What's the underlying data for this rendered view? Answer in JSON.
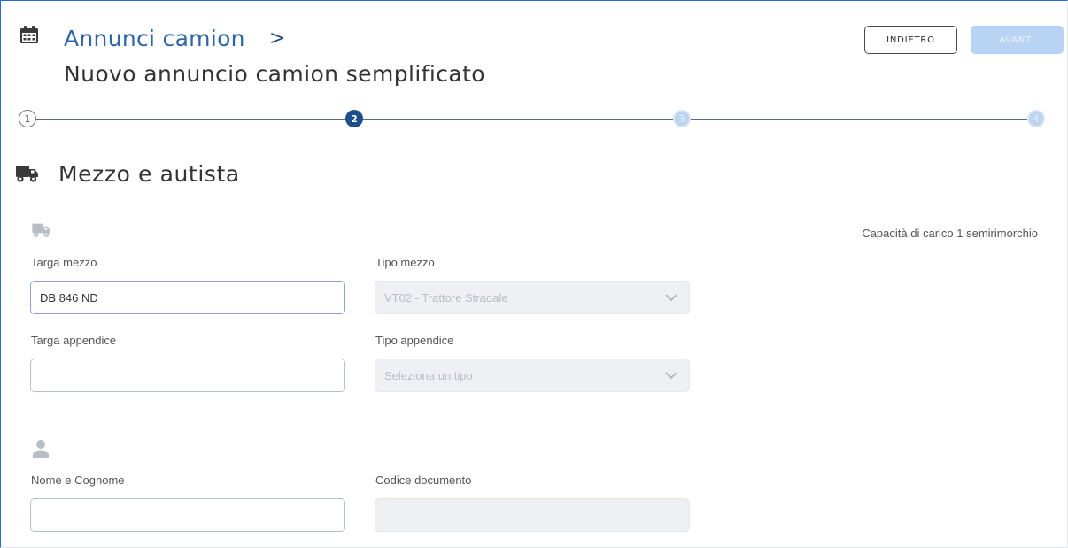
{
  "header": {
    "breadcrumb_link": "Annunci camion",
    "breadcrumb_separator": ">",
    "page_title": "Nuovo annuncio camion semplificato",
    "back_button": "INDIETRO",
    "next_button": "AVANTI"
  },
  "stepper": {
    "current_step": 2,
    "steps": [
      {
        "number": "1",
        "state": "completed"
      },
      {
        "number": "2",
        "state": "current"
      },
      {
        "number": "3",
        "state": "upcoming"
      },
      {
        "number": "4",
        "state": "upcoming"
      }
    ]
  },
  "section": {
    "title": "Mezzo e autista",
    "icon": "truck-icon"
  },
  "vehicle": {
    "icon": "truck-icon",
    "capacity_text": "Capacità di carico 1 semirimorchio",
    "plate_label": "Targa mezzo",
    "plate_value": "DB 846 ND",
    "type_label": "Tipo mezzo",
    "type_value": "VT02 - Trattore Stradale",
    "trailer_plate_label": "Targa appendice",
    "trailer_plate_value": "",
    "trailer_type_label": "Tipo appendice",
    "trailer_type_placeholder": "Seleziona un tipo"
  },
  "driver": {
    "icon": "person-icon",
    "name_label": "Nome e Cognome",
    "name_value": "",
    "document_label": "Codice documento",
    "document_value": ""
  },
  "colors": {
    "primary": "#2f65a8",
    "step_active": "#1c4f8c",
    "step_inactive": "#bdd4ef",
    "next_button_disabled": "#b8d3f3",
    "disabled_field": "#eef0f3"
  }
}
